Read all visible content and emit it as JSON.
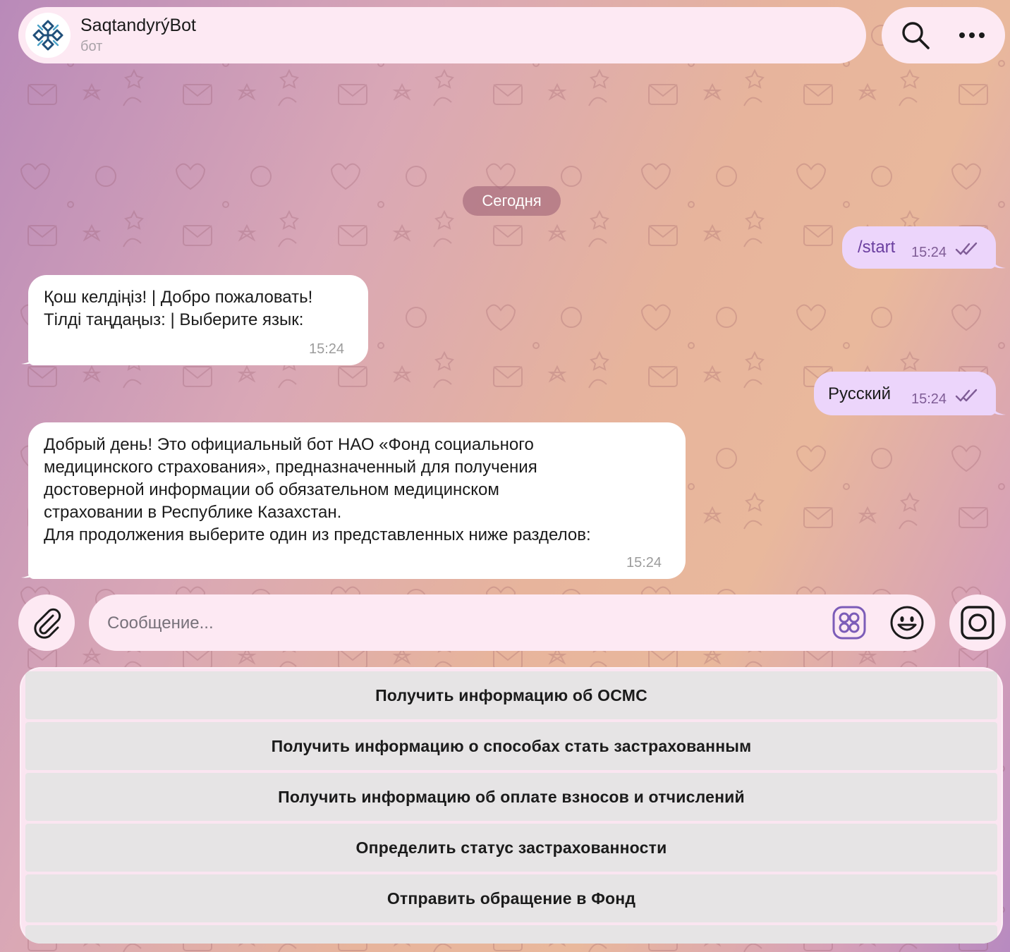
{
  "header": {
    "title": "SaqtandyrýBot",
    "subtitle": "бот",
    "avatar_icon": "snowflake-logo-icon",
    "search_icon": "search-icon",
    "more_icon": "more-dots-icon"
  },
  "date_separator": "Сегодня",
  "messages": [
    {
      "direction": "out",
      "text": "/start",
      "time": "15:24",
      "status_icon": "double-check-icon"
    },
    {
      "direction": "in",
      "lines": [
        "Қош келдіңіз! | Добро пожаловать!",
        "Тілді таңдаңыз: | Выберите язык:"
      ],
      "time": "15:24"
    },
    {
      "direction": "out",
      "text": "Русский",
      "time": "15:24",
      "status_icon": "double-check-icon"
    },
    {
      "direction": "in",
      "lines": [
        "Добрый день! Это официальный бот НАО «Фонд социального",
        "медицинского страхования», предназначенный для получения",
        "достоверной информации об обязательном медицинском",
        "страховании в Республике Казахстан.",
        "Для продолжения выберите один из представленных ниже разделов:"
      ],
      "time": "15:24"
    }
  ],
  "composer": {
    "placeholder": "Сообщение...",
    "attach_icon": "paperclip-icon",
    "keyboard_icon": "bot-keyboard-icon",
    "emoji_icon": "emoji-icon",
    "camera_icon": "camera-icon"
  },
  "keyboard_buttons": [
    "Получить информацию об ОСМС",
    "Получить информацию о способах стать застрахованным",
    "Получить информацию об оплате взносов и отчислений",
    "Определить статус застрахованности",
    "Отправить обращение в Фонд"
  ],
  "colors": {
    "accent": "#7c5cb8",
    "outgoing_bubble": "#ecd5fb",
    "incoming_bubble": "#ffffff"
  }
}
